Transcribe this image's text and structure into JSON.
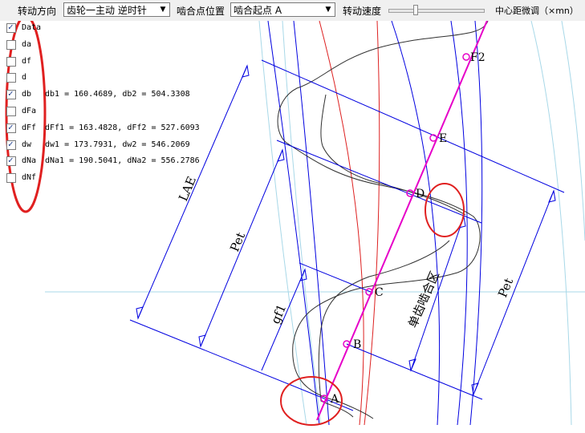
{
  "toolbar": {
    "rotation_label": "转动方向",
    "rotation_value": "齿轮一主动 逆时针",
    "mesh_label": "啮合点位置",
    "mesh_value": "啮合起点 A",
    "speed_label": "转动速度",
    "speed_slider_fraction": 0.27,
    "center_label": "中心距微调（×mn）"
  },
  "checkboxes": [
    {
      "label": "Data",
      "checked": true,
      "value": ""
    },
    {
      "label": "da",
      "checked": false,
      "value": ""
    },
    {
      "label": "df",
      "checked": false,
      "value": ""
    },
    {
      "label": "d",
      "checked": false,
      "value": ""
    },
    {
      "label": "db",
      "checked": true,
      "value": "db1 = 160.4689,  db2 = 504.3308"
    },
    {
      "label": "dFa",
      "checked": false,
      "value": ""
    },
    {
      "label": "dFf",
      "checked": true,
      "value": "dFf1 = 163.4828,  dFf2 = 527.6093"
    },
    {
      "label": "dw",
      "checked": true,
      "value": "dw1 = 173.7931,  dw2 = 546.2069"
    },
    {
      "label": "dNa",
      "checked": true,
      "value": "dNa1 = 190.5041,  dNa2 = 556.2786"
    },
    {
      "label": "dNf",
      "checked": false,
      "value": ""
    }
  ],
  "points": {
    "A": "A",
    "B": "B",
    "C": "C",
    "D": "D",
    "E": "E",
    "F2": "F2"
  },
  "dimensions": {
    "lae": "LAE",
    "pet_left": "Pet",
    "gf1": "gf1",
    "single_zone": "单齿啮合区",
    "pet_right": "Pet"
  },
  "colors": {
    "line_of_action": "#e600c8",
    "dimension": "#0000e0",
    "circle_light": "#a8d8e8",
    "circle_red": "#dd2020",
    "annotation": "#e02020",
    "profile": "#303030"
  }
}
